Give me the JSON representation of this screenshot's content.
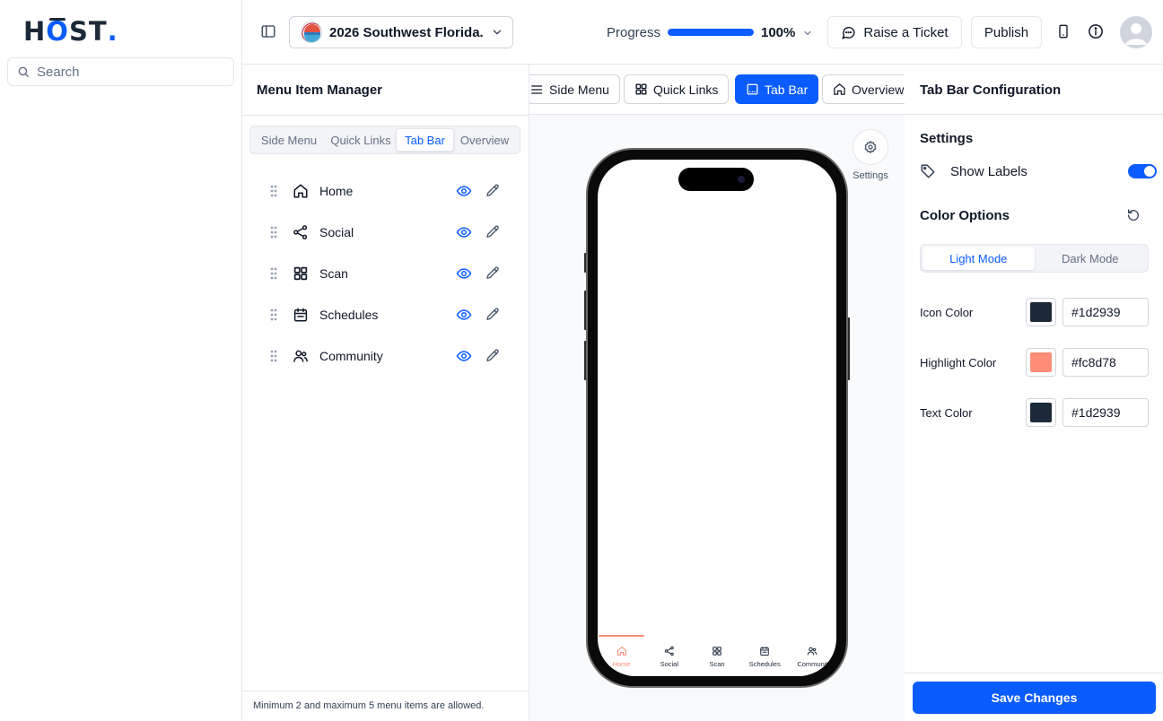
{
  "brand": {
    "logo_h": "H",
    "logo_o": "O",
    "logo_st": "ST",
    "logo_dot": "."
  },
  "search": {
    "placeholder": "Search"
  },
  "header": {
    "event_name": "2026 Southwest Florida...",
    "progress_label": "Progress",
    "progress_value": "100%",
    "progress_fraction": 1.0,
    "raise_ticket": "Raise a Ticket",
    "publish": "Publish"
  },
  "manager": {
    "title": "Menu Item Manager",
    "tabs": [
      {
        "label": "Side Menu",
        "active": false
      },
      {
        "label": "Quick Links",
        "active": false
      },
      {
        "label": "Tab Bar",
        "active": true
      },
      {
        "label": "Overview",
        "active": false
      }
    ],
    "items": [
      {
        "label": "Home",
        "icon": "home-icon"
      },
      {
        "label": "Social",
        "icon": "share-icon"
      },
      {
        "label": "Scan",
        "icon": "grid-icon"
      },
      {
        "label": "Schedules",
        "icon": "calendar-icon"
      },
      {
        "label": "Community",
        "icon": "users-icon"
      }
    ],
    "note": "Minimum 2 and maximum 5 menu items are allowed."
  },
  "preview": {
    "tabs": [
      {
        "label": "Side Menu",
        "icon": "menu-icon",
        "active": false
      },
      {
        "label": "Quick Links",
        "icon": "grid-icon",
        "active": false
      },
      {
        "label": "Tab Bar",
        "icon": "tabbar-icon",
        "active": true
      },
      {
        "label": "Overview",
        "icon": "home-icon",
        "active": false
      }
    ],
    "settings_label": "Settings",
    "tabbar": [
      {
        "label": "Home",
        "active": true
      },
      {
        "label": "Social",
        "active": false
      },
      {
        "label": "Scan",
        "active": false
      },
      {
        "label": "Schedules",
        "active": false
      },
      {
        "label": "Communit",
        "active": false
      }
    ]
  },
  "config": {
    "title": "Tab Bar Configuration",
    "settings_heading": "Settings",
    "show_labels": "Show Labels",
    "show_labels_on": true,
    "color_options": "Color Options",
    "modes": [
      {
        "label": "Light Mode",
        "active": true
      },
      {
        "label": "Dark Mode",
        "active": false
      }
    ],
    "colors": [
      {
        "label": "Icon Color",
        "hex": "#1d2939"
      },
      {
        "label": "Highlight Color",
        "hex": "#fc8d78"
      },
      {
        "label": "Text Color",
        "hex": "#1d2939"
      }
    ],
    "save": "Save Changes"
  },
  "theme": {
    "accent": "#0b5cff",
    "highlight": "#fc8d78",
    "icon": "#1d2939"
  }
}
